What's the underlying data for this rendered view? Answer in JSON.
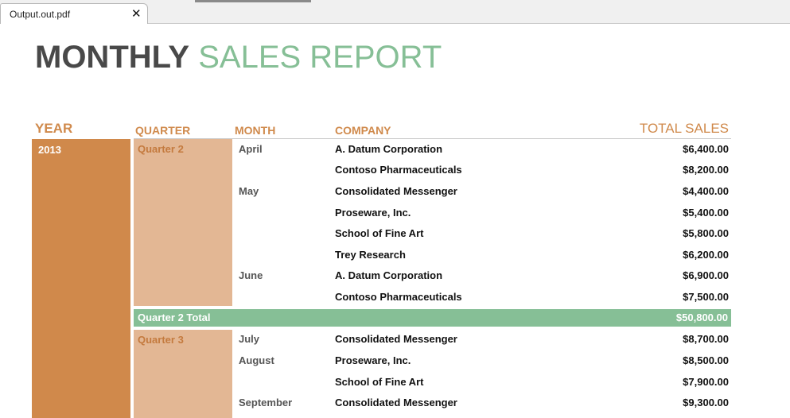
{
  "viewer": {
    "tab_title": "Output.out.pdf",
    "close_glyph": "✕"
  },
  "report": {
    "title_bold": "MONTHLY",
    "title_light": "SALES REPORT",
    "headers": {
      "year": "YEAR",
      "quarter": "QUARTER",
      "month": "MONTH",
      "company": "COMPANY",
      "total_sales": "TOTAL SALES"
    },
    "year": "2013",
    "quarter2": {
      "label": "Quarter 2",
      "total_label": "Quarter 2 Total",
      "total_value": "$50,800.00",
      "rows": [
        {
          "month": "April",
          "company": "A. Datum Corporation",
          "amount": "$6,400.00"
        },
        {
          "month": "",
          "company": "Contoso Pharmaceuticals",
          "amount": "$8,200.00"
        },
        {
          "month": "May",
          "company": "Consolidated Messenger",
          "amount": "$4,400.00"
        },
        {
          "month": "",
          "company": "Proseware, Inc.",
          "amount": "$5,400.00"
        },
        {
          "month": "",
          "company": "School of Fine Art",
          "amount": "$5,800.00"
        },
        {
          "month": "",
          "company": "Trey Research",
          "amount": "$6,200.00"
        },
        {
          "month": "June",
          "company": "A. Datum Corporation",
          "amount": "$6,900.00"
        },
        {
          "month": "",
          "company": "Contoso Pharmaceuticals",
          "amount": "$7,500.00"
        }
      ]
    },
    "quarter3": {
      "label": "Quarter 3",
      "rows": [
        {
          "month": "July",
          "company": "Consolidated Messenger",
          "amount": "$8,700.00"
        },
        {
          "month": "August",
          "company": "Proseware, Inc.",
          "amount": "$8,500.00"
        },
        {
          "month": "",
          "company": "School of Fine Art",
          "amount": "$7,900.00"
        },
        {
          "month": "September",
          "company": "Consolidated Messenger",
          "amount": "$9,300.00"
        }
      ]
    }
  }
}
